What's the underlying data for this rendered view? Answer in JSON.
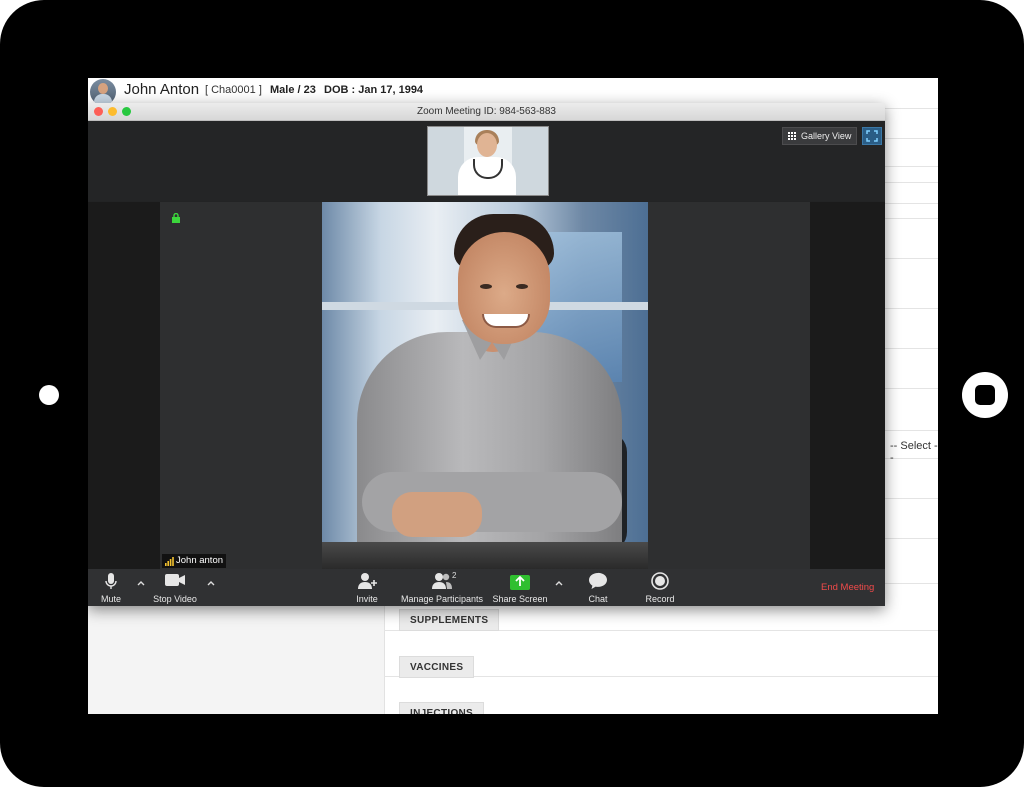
{
  "ehr": {
    "patient_name": "John Anton",
    "patient_code": "[ Cha0001 ]",
    "gender_age": "Male / 23",
    "dob": "DOB : Jan 17, 1994",
    "select_placeholder": "-- Select --",
    "sections": [
      "SUPPLEMENTS",
      "VACCINES",
      "INJECTIONS"
    ]
  },
  "zoom": {
    "title": "Zoom Meeting ID: 984-563-883",
    "gallery_view_label": "Gallery View",
    "participant_name": "John anton",
    "participant_count": "2",
    "toolbar": {
      "mute": "Mute",
      "stop_video": "Stop Video",
      "invite": "Invite",
      "manage_participants": "Manage Participants",
      "share_screen": "Share Screen",
      "chat": "Chat",
      "record": "Record",
      "end_meeting": "End Meeting"
    }
  },
  "colors": {
    "end_meeting": "#f04a4a",
    "share_screen": "#2fbf2f",
    "lock": "#3cd63c",
    "traffic_close": "#fd5f57",
    "traffic_min": "#fdbc2e",
    "traffic_max": "#28c840"
  },
  "icons": [
    "microphone-icon",
    "video-camera-icon",
    "caret-up-icon",
    "invite-icon",
    "participants-icon",
    "share-screen-icon",
    "chat-icon",
    "record-icon",
    "grid-icon",
    "fullscreen-icon",
    "lock-icon",
    "signal-icon"
  ]
}
